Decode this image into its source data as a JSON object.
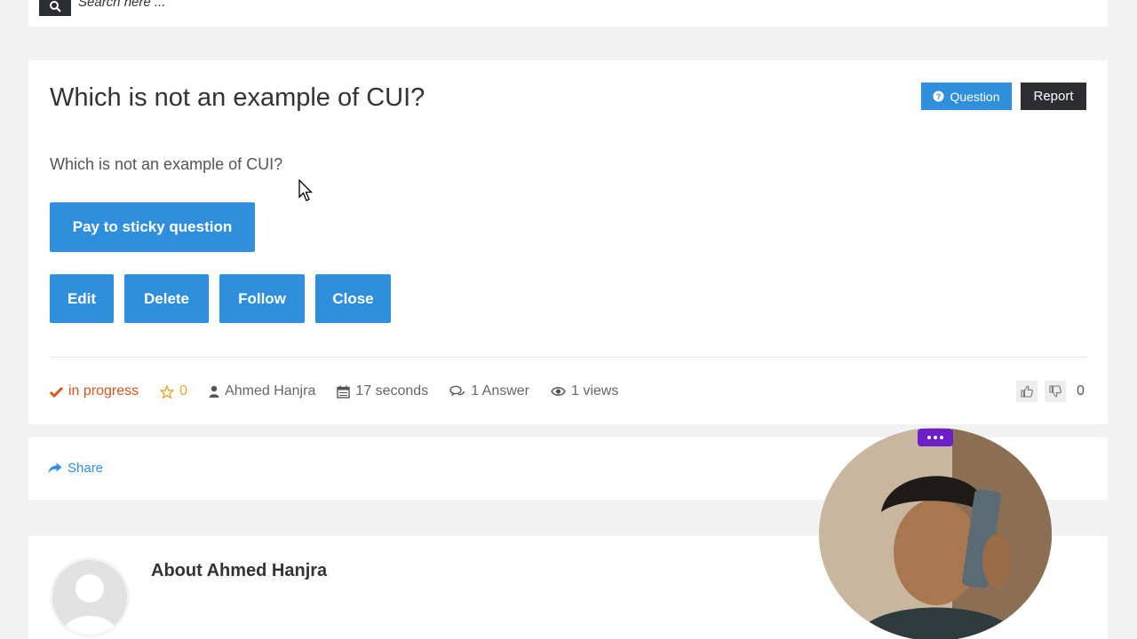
{
  "search": {
    "placeholder": "Search here ..."
  },
  "question": {
    "title": "Which is not an example of CUI?",
    "body": "Which is not an example of CUI?",
    "badge_label": "Question",
    "report_label": "Report"
  },
  "actions": {
    "sticky_label": "Pay to sticky question",
    "edit_label": "Edit",
    "delete_label": "Delete",
    "follow_label": "Follow",
    "close_label": "Close"
  },
  "meta": {
    "status": "in progress",
    "stars": "0",
    "author": "Ahmed Hanjra",
    "time": "17 seconds",
    "answers": "1 Answer",
    "views": "1 views",
    "votes": "0"
  },
  "share": {
    "label": "Share"
  },
  "about": {
    "title": "About Ahmed Hanjra"
  },
  "colors": {
    "accent": "#2f8fdd",
    "dark": "#2b2d30",
    "status": "#d9541f",
    "star": "#e6a935",
    "cam_menu": "#6a1fc7"
  },
  "icons": [
    "search-icon",
    "question-circle-icon",
    "check-icon",
    "star-icon",
    "user-icon",
    "calendar-icon",
    "comments-icon",
    "eye-icon",
    "thumbs-up-icon",
    "thumbs-down-icon",
    "share-icon"
  ]
}
